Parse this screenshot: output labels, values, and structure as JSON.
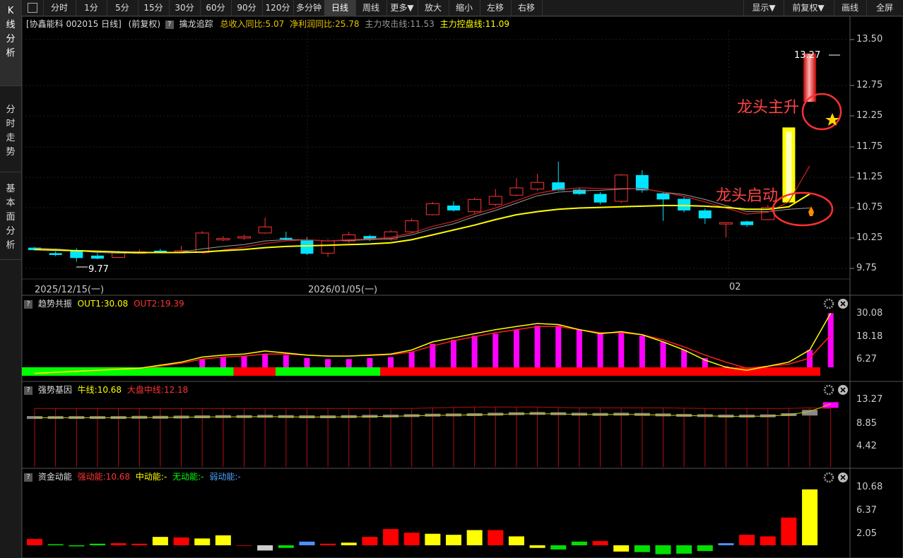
{
  "sidebar": {
    "items": [
      {
        "label": "K\n线\n分\n析"
      },
      {
        "label": "分\n时\n走\n势"
      },
      {
        "label": "基\n本\n面\n分\n析"
      }
    ]
  },
  "toolbar": {
    "buttons": [
      "分时",
      "1分",
      "5分",
      "15分",
      "30分",
      "60分",
      "90分",
      "120分",
      "多分钟",
      "日线",
      "周线",
      "更多▼",
      "放大",
      "缩小",
      "左移",
      "右移"
    ],
    "right_buttons": [
      "显示▼",
      "前复权▼",
      "画线",
      "全屏"
    ],
    "active": "日线"
  },
  "main_panel": {
    "stock_label": "[协鑫能科 002015 日线]",
    "adjust_label": "(前复权)",
    "indicator_name": "擒龙追踪",
    "stats": [
      {
        "text": "总收入同比:5.07",
        "color": "#e6c200"
      },
      {
        "text": "净利润同比:25.78",
        "color": "#e6c200"
      },
      {
        "text": "主力攻击线:11.53",
        "color": "#999999"
      },
      {
        "text": "主力控盘线:11.09",
        "color": "#ffff00"
      }
    ],
    "y_ticks": [
      "13.50",
      "12.75",
      "12.25",
      "11.75",
      "11.25",
      "10.75",
      "10.25",
      "9.75"
    ],
    "x_dates": [
      "2025/12/15(一)",
      "2026/01/05(一)",
      "02"
    ],
    "high_label": "13.27",
    "low_label": "9.77",
    "annotation_top": "龙头主升",
    "annotation_bottom": "龙头启动"
  },
  "panel2": {
    "name": "趋势共振",
    "out1": "OUT1:30.08",
    "out2": "OUT2:19.39",
    "y_ticks": [
      "30.08",
      "18.18",
      "6.27"
    ]
  },
  "panel3": {
    "name": "强势基因",
    "line1": "牛线:10.68",
    "line2": "大盘中线:12.18",
    "y_ticks": [
      "13.27",
      "8.85",
      "4.42"
    ]
  },
  "panel4": {
    "name": "资金动能",
    "s1": "强动能:10.68",
    "s2": "中动能:-",
    "s3": "无动能:-",
    "s4": "弱动能:-",
    "y_ticks": [
      "10.68",
      "6.37",
      "2.05"
    ]
  },
  "colors": {
    "up": "#ff3333",
    "down": "#00e5ff",
    "ma_yellow": "#ffff00",
    "ma_red": "#d02020",
    "ma_gray": "#9a9a9a",
    "magenta": "#ff00ff"
  },
  "chart_data": [
    {
      "type": "candlestick",
      "title": "协鑫能科 002015 日线",
      "ylim": [
        9.7,
        13.55
      ],
      "candles": [
        {
          "o": 10.09,
          "c": 10.05,
          "h": 10.1,
          "l": 10.04
        },
        {
          "o": 10.0,
          "c": 9.97,
          "h": 10.03,
          "l": 9.95
        },
        {
          "o": 10.05,
          "c": 9.92,
          "h": 10.08,
          "l": 9.86
        },
        {
          "o": 9.96,
          "c": 9.91,
          "h": 10.0,
          "l": 9.9
        },
        {
          "o": 9.93,
          "c": 10.01,
          "h": 10.04,
          "l": 9.92
        },
        {
          "o": 10.02,
          "c": 10.02,
          "h": 10.06,
          "l": 9.99
        },
        {
          "o": 10.04,
          "c": 10.02,
          "h": 10.07,
          "l": 10.0
        },
        {
          "o": 10.03,
          "c": 10.04,
          "h": 10.12,
          "l": 10.0
        },
        {
          "o": 10.01,
          "c": 10.33,
          "h": 10.36,
          "l": 10.0
        },
        {
          "o": 10.24,
          "c": 10.24,
          "h": 10.28,
          "l": 10.2
        },
        {
          "o": 10.25,
          "c": 10.27,
          "h": 10.3,
          "l": 10.22
        },
        {
          "o": 10.33,
          "c": 10.43,
          "h": 10.58,
          "l": 10.32
        },
        {
          "o": 10.25,
          "c": 10.23,
          "h": 10.35,
          "l": 10.21
        },
        {
          "o": 10.21,
          "c": 9.99,
          "h": 10.26,
          "l": 9.97
        },
        {
          "o": 10.0,
          "c": 10.2,
          "h": 10.23,
          "l": 9.94
        },
        {
          "o": 10.2,
          "c": 10.3,
          "h": 10.35,
          "l": 10.17
        },
        {
          "o": 10.28,
          "c": 10.22,
          "h": 10.3,
          "l": 10.2
        },
        {
          "o": 10.23,
          "c": 10.35,
          "h": 10.38,
          "l": 10.2
        },
        {
          "o": 10.35,
          "c": 10.53,
          "h": 10.57,
          "l": 10.33
        },
        {
          "o": 10.63,
          "c": 10.81,
          "h": 10.84,
          "l": 10.62
        },
        {
          "o": 10.78,
          "c": 10.7,
          "h": 10.85,
          "l": 10.68
        },
        {
          "o": 10.68,
          "c": 10.88,
          "h": 10.91,
          "l": 10.65
        },
        {
          "o": 10.8,
          "c": 10.93,
          "h": 11.05,
          "l": 10.77
        },
        {
          "o": 10.95,
          "c": 11.07,
          "h": 11.23,
          "l": 10.93
        },
        {
          "o": 11.05,
          "c": 11.16,
          "h": 11.3,
          "l": 11.02
        },
        {
          "o": 11.16,
          "c": 11.03,
          "h": 11.5,
          "l": 11.02
        },
        {
          "o": 11.04,
          "c": 10.97,
          "h": 11.07,
          "l": 10.95
        },
        {
          "o": 10.97,
          "c": 10.83,
          "h": 11.0,
          "l": 10.8
        },
        {
          "o": 10.85,
          "c": 11.28,
          "h": 11.3,
          "l": 10.82
        },
        {
          "o": 11.28,
          "c": 11.03,
          "h": 11.36,
          "l": 10.99
        },
        {
          "o": 10.98,
          "c": 10.88,
          "h": 11.0,
          "l": 10.53
        },
        {
          "o": 10.89,
          "c": 10.7,
          "h": 10.92,
          "l": 10.67
        },
        {
          "o": 10.7,
          "c": 10.57,
          "h": 10.73,
          "l": 10.48
        },
        {
          "o": 10.5,
          "c": 10.5,
          "h": 10.5,
          "l": 10.26
        },
        {
          "o": 10.52,
          "c": 10.46,
          "h": 10.53,
          "l": 10.43
        },
        {
          "o": 10.55,
          "c": 10.75,
          "h": 10.79,
          "l": 10.54
        },
        {
          "o": 10.83,
          "c": 12.06,
          "h": 12.06,
          "l": 10.83
        },
        {
          "o": 12.48,
          "c": 13.27,
          "h": 13.27,
          "l": 12.48
        }
      ],
      "ma_gray": [
        10.08,
        10.07,
        10.04,
        10.01,
        10.0,
        10.0,
        10.01,
        10.02,
        10.07,
        10.11,
        10.14,
        10.2,
        10.22,
        10.22,
        10.2,
        10.21,
        10.22,
        10.24,
        10.3,
        10.4,
        10.48,
        10.6,
        10.7,
        10.82,
        10.94,
        11.0,
        11.02,
        11.03,
        11.05,
        11.06,
        11.0,
        10.96,
        10.88,
        10.78,
        10.68,
        10.68,
        10.72,
        10.74
      ],
      "ma_yellow": [
        10.06,
        10.05,
        10.04,
        10.03,
        10.02,
        10.01,
        10.01,
        10.01,
        10.02,
        10.04,
        10.06,
        10.09,
        10.11,
        10.12,
        10.13,
        10.14,
        10.15,
        10.17,
        10.22,
        10.3,
        10.38,
        10.46,
        10.55,
        10.63,
        10.68,
        10.72,
        10.74,
        10.75,
        10.76,
        10.77,
        10.78,
        10.78,
        10.77,
        10.75,
        10.72,
        10.72,
        10.76,
        10.97
      ],
      "ma_red": [
        null,
        null,
        null,
        null,
        null,
        null,
        null,
        null,
        10.0,
        10.05,
        10.1,
        10.16,
        10.2,
        10.22,
        10.2,
        10.22,
        10.23,
        10.26,
        10.33,
        10.44,
        10.52,
        10.64,
        10.74,
        10.86,
        10.98,
        11.04,
        11.07,
        11.06,
        11.06,
        11.06,
        11.0,
        10.93,
        10.84,
        10.74,
        10.64,
        10.67,
        10.84,
        11.43
      ]
    },
    {
      "type": "bar",
      "title": "趋势共振",
      "ylim": [
        0,
        33
      ],
      "values": [
        2.0,
        2.5,
        3.0,
        3.5,
        4.0,
        4.5,
        5.0,
        6.0,
        7.5,
        8.5,
        9.0,
        10.0,
        9.5,
        8.0,
        7.5,
        7.5,
        8.0,
        8.5,
        11.0,
        15.0,
        17.0,
        19.0,
        20.0,
        22.0,
        24.0,
        24.0,
        22.0,
        20.0,
        20.5,
        19.0,
        16.0,
        12.0,
        8.0,
        4.0,
        1.5,
        1.5,
        2.0,
        12.0,
        30.08
      ],
      "out1": [
        0.5,
        1.0,
        1.5,
        2.0,
        2.5,
        3.0,
        4.5,
        6.0,
        8.5,
        9.5,
        10.0,
        11.5,
        10.5,
        9.5,
        9.0,
        9.0,
        9.5,
        10.0,
        12.0,
        16.0,
        18.0,
        20.0,
        22.0,
        23.5,
        25.0,
        24.5,
        22.0,
        20.0,
        21.0,
        19.5,
        16.0,
        12.0,
        7.0,
        3.5,
        2.0,
        4.0,
        6.0,
        12.0,
        30.08
      ],
      "out2": [
        0.5,
        1.0,
        1.5,
        2.0,
        2.5,
        3.0,
        4.0,
        5.5,
        7.5,
        8.5,
        9.0,
        10.0,
        10.0,
        9.5,
        9.0,
        9.0,
        9.3,
        9.7,
        11.0,
        14.0,
        16.5,
        18.5,
        20.5,
        22.0,
        23.5,
        23.5,
        22.0,
        20.5,
        20.5,
        19.5,
        17.0,
        13.5,
        9.5,
        6.0,
        3.0,
        4.0,
        5.0,
        8.0,
        19.39
      ],
      "state_band": [
        {
          "from": 0,
          "to": 10,
          "color": "green"
        },
        {
          "from": 10,
          "to": 12,
          "color": "red"
        },
        {
          "from": 12,
          "to": 17,
          "color": "green"
        },
        {
          "from": 17,
          "to": 38,
          "color": "red"
        }
      ]
    },
    {
      "type": "bar",
      "title": "强势基因",
      "ylim": [
        0,
        14
      ],
      "values": [
        10.3,
        10.3,
        10.3,
        10.3,
        10.3,
        10.35,
        10.35,
        10.4,
        10.45,
        10.5,
        10.5,
        10.55,
        10.5,
        10.45,
        10.45,
        10.5,
        10.55,
        10.6,
        10.7,
        10.8,
        10.85,
        10.9,
        11.0,
        11.1,
        11.15,
        11.1,
        11.0,
        10.95,
        11.0,
        10.95,
        10.85,
        10.75,
        10.7,
        10.6,
        10.6,
        10.65,
        10.9,
        11.6,
        13.2
      ],
      "upper": [
        12.2,
        12.2,
        12.2,
        12.2,
        12.2,
        12.2,
        12.2,
        12.2,
        12.2,
        12.2,
        12.2,
        12.2,
        12.2,
        12.2,
        12.2,
        12.2,
        12.2,
        12.2,
        12.2,
        12.3,
        12.4,
        12.5,
        12.5,
        12.5,
        12.5,
        12.4,
        12.3,
        12.3,
        12.3,
        12.3,
        12.3,
        12.25,
        12.2,
        12.2,
        12.2,
        12.2,
        12.2,
        12.3,
        12.18
      ]
    },
    {
      "type": "bar",
      "title": "资金动能",
      "ylim": [
        -1.5,
        11.2
      ],
      "values": [
        1.2,
        0.2,
        -0.2,
        0.3,
        0.4,
        0.3,
        1.6,
        1.5,
        1.3,
        1.9,
        -0.1,
        -1.0,
        -0.5,
        0.7,
        0.3,
        0.5,
        1.6,
        3.1,
        2.4,
        2.2,
        2.0,
        2.9,
        2.9,
        1.7,
        -0.5,
        -0.8,
        0.7,
        0.8,
        -1.2,
        -1.3,
        -1.7,
        -1.6,
        -1.1,
        0.4,
        2.0,
        1.7,
        5.3,
        10.68
      ],
      "colors": [
        "red",
        "green",
        "green",
        "green",
        "red",
        "red",
        "yellow",
        "red",
        "yellow",
        "yellow",
        "red",
        "white",
        "green",
        "blue",
        "red",
        "yellow",
        "red",
        "red",
        "red",
        "yellow",
        "yellow",
        "yellow",
        "red",
        "yellow",
        "yellow",
        "green",
        "green",
        "red",
        "yellow",
        "green",
        "green",
        "green",
        "green",
        "blue",
        "red",
        "red",
        "red",
        "yellow",
        "red",
        "red"
      ]
    }
  ]
}
